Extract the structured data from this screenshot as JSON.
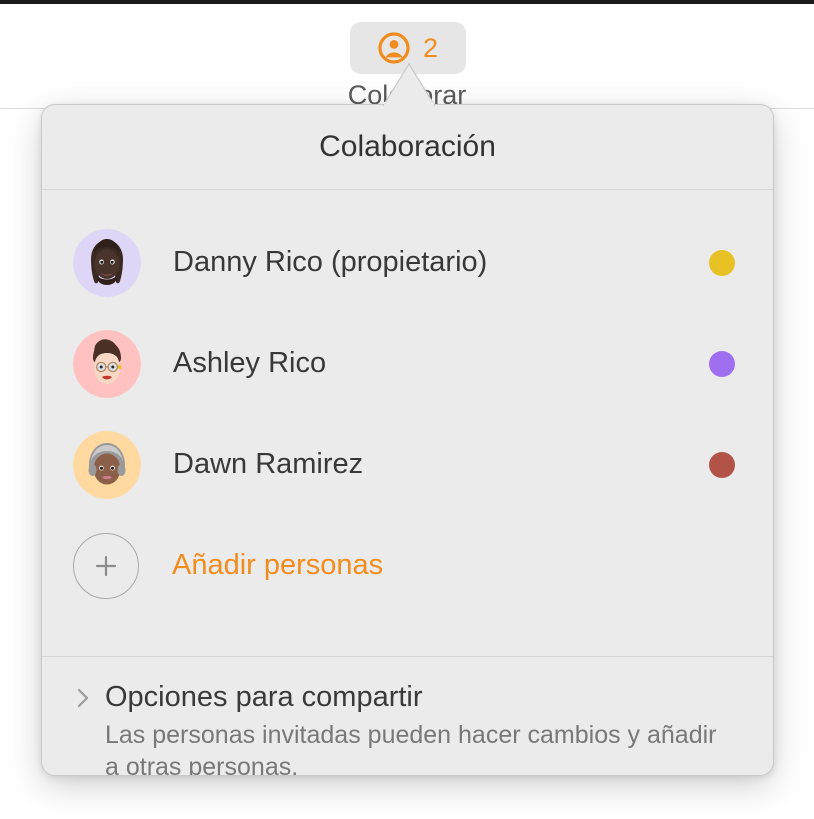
{
  "toolbar": {
    "collaborate_button_label": "Colaborar",
    "participant_count": "2",
    "person_icon": "person-circle-icon",
    "accent_color": "#f28c1e"
  },
  "popover": {
    "title": "Colaboración",
    "participants": [
      {
        "name": "Danny Rico (propietario)",
        "avatar_icon": "memoji-avatar",
        "avatar_bg": "#ded6f7",
        "status_color": "#e8c124"
      },
      {
        "name": "Ashley Rico",
        "avatar_icon": "memoji-avatar",
        "avatar_bg": "#ffc2c0",
        "status_color": "#a06ef0"
      },
      {
        "name": "Dawn Ramirez",
        "avatar_icon": "memoji-avatar",
        "avatar_bg": "#ffd9a0",
        "status_color": "#b35347"
      }
    ],
    "add_people": {
      "label": "Añadir personas",
      "icon": "plus-icon"
    },
    "footer": {
      "disclosure_icon": "chevron-right-icon",
      "title": "Opciones para compartir",
      "description": "Las personas invitadas pueden hacer cambios y añadir a otras personas."
    }
  }
}
